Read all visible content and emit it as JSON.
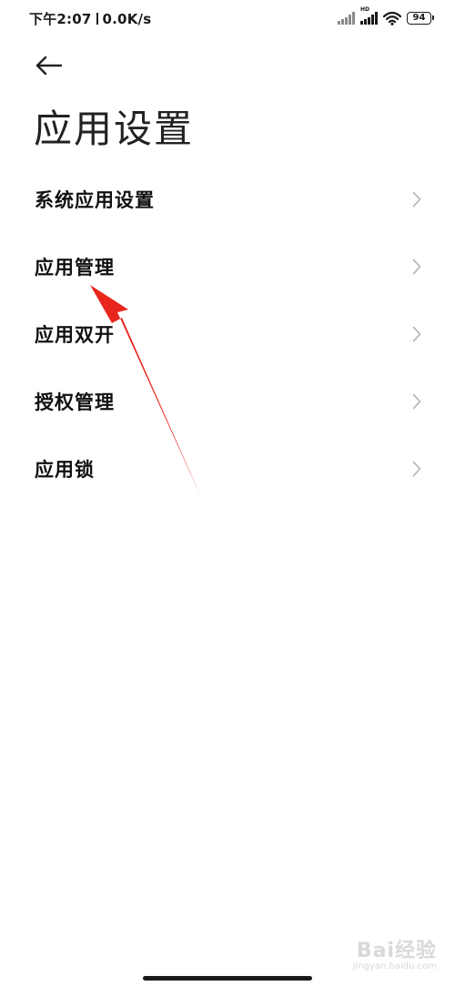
{
  "status_bar": {
    "time": "下午2:07",
    "network_speed": "0.0K/s",
    "hd_label": "HD",
    "battery": "94",
    "icons": [
      "signal-icon",
      "signal-hd-icon",
      "wifi-icon",
      "battery-icon"
    ]
  },
  "header": {
    "back_icon": "arrow-left-icon",
    "title": "应用设置"
  },
  "list": {
    "items": [
      {
        "label": "系统应用设置"
      },
      {
        "label": "应用管理"
      },
      {
        "label": "应用双开"
      },
      {
        "label": "授权管理"
      },
      {
        "label": "应用锁"
      }
    ],
    "chevron_icon": "chevron-right-icon"
  },
  "annotation": {
    "arrow_color": "#e8261e",
    "points_to": "应用管理"
  },
  "watermark": {
    "brand": "Bai经验",
    "sub": "jingyan.baidu.com"
  },
  "colors": {
    "background": "#ffffff",
    "text": "#111111",
    "chevron": "#b0b0b0"
  }
}
